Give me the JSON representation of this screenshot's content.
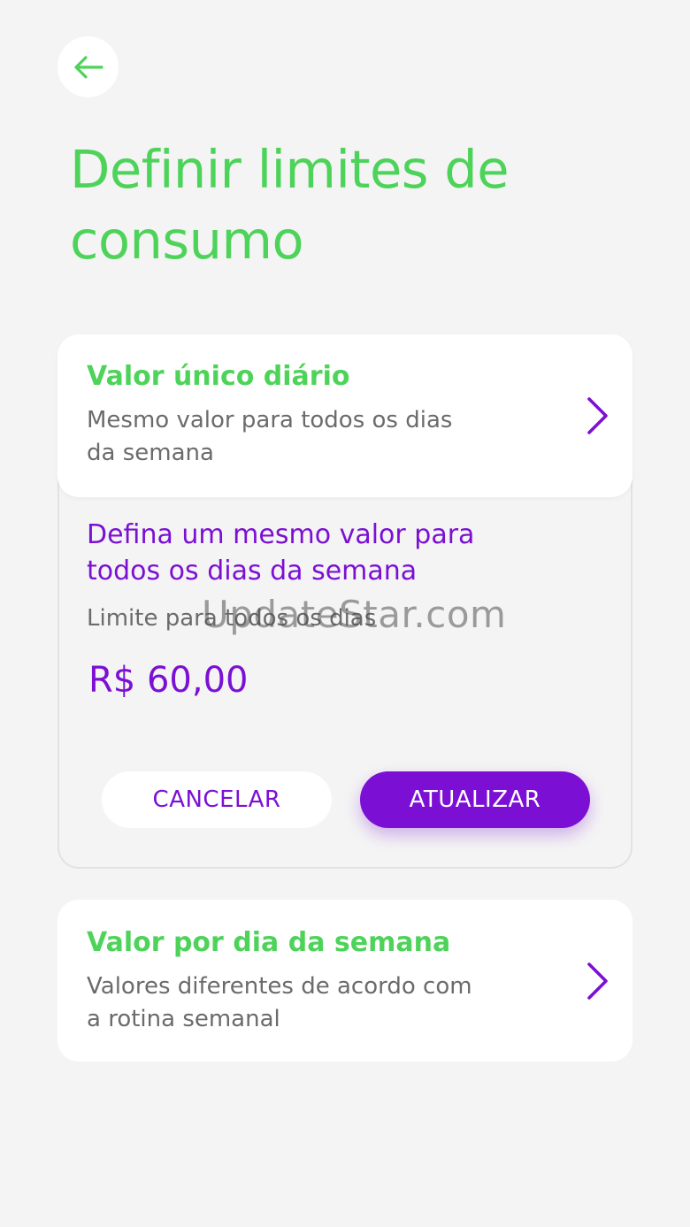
{
  "header": {
    "back_icon": "arrow-left-icon",
    "title": "Definir limites de consumo"
  },
  "colors": {
    "green": "#4ed35a",
    "purple": "#7b10d4",
    "gray_text": "#6b6b6b",
    "background": "#f4f4f4"
  },
  "daily_option": {
    "title": "Valor único diário",
    "description": "Mesmo valor para todos os dias da semana",
    "chevron_icon": "chevron-right-icon"
  },
  "daily_panel": {
    "title": "Defina um mesmo valor para todos os dias da semana",
    "limit_label": "Limite para todos os dias",
    "limit_value": "R$ 60,00",
    "cancel_label": "CANCELAR",
    "update_label": "ATUALIZAR"
  },
  "weekly_option": {
    "title": "Valor por dia da semana",
    "description": "Valores diferentes de acordo com a rotina semanal",
    "chevron_icon": "chevron-right-icon"
  },
  "watermark": "UpdateStar.com"
}
